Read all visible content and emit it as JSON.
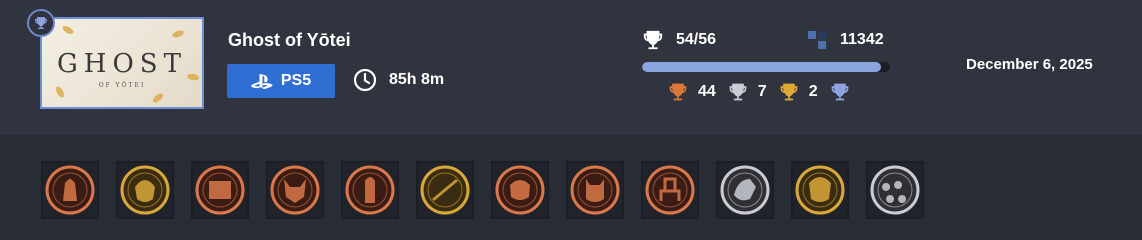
{
  "game": {
    "title": "Ghost of Yōtei",
    "cover_logo": "GHOST",
    "cover_subtitle": "OF YŌTEI",
    "platform": "PS5",
    "playtime": "85h 8m"
  },
  "stats": {
    "trophies_earned": "54/56",
    "points": "11342",
    "progress_fraction": 0.964,
    "bronze": "44",
    "silver": "7",
    "gold": "2"
  },
  "date": "December 6, 2025",
  "colors": {
    "accent_blue": "#2f6ed3",
    "progress": "#8aa4e0",
    "bronze": "#d9783a",
    "silver": "#c8ccd4",
    "gold": "#e0a935",
    "platinum": "#8fa3e0"
  },
  "trophy_icons": [
    {
      "name": "figures-trophy-icon",
      "tier": "bronze"
    },
    {
      "name": "masked-face-trophy-icon",
      "tier": "gold"
    },
    {
      "name": "scroll-trophy-icon",
      "tier": "bronze"
    },
    {
      "name": "fox-trophy-icon",
      "tier": "bronze"
    },
    {
      "name": "hooded-figure-trophy-icon",
      "tier": "bronze"
    },
    {
      "name": "sword-trophy-icon",
      "tier": "gold"
    },
    {
      "name": "oni-mask-trophy-icon",
      "tier": "bronze"
    },
    {
      "name": "demon-mask-trophy-icon",
      "tier": "bronze"
    },
    {
      "name": "shrine-trophy-icon",
      "tier": "bronze"
    },
    {
      "name": "wolf-trophy-icon",
      "tier": "silver"
    },
    {
      "name": "golden-mask-trophy-icon",
      "tier": "gold"
    },
    {
      "name": "skulls-trophy-icon",
      "tier": "silver"
    }
  ]
}
